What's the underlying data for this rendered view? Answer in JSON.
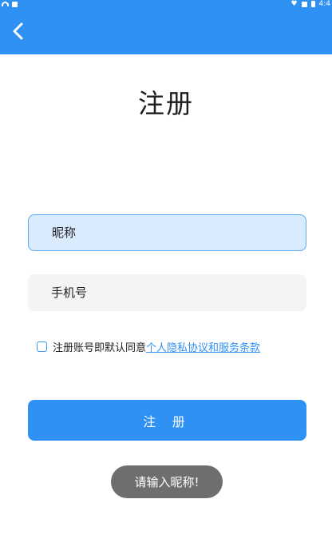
{
  "status_bar": {
    "time": "4:4",
    "icons": [
      "wifi-icon",
      "sim-icon",
      "signal-icon",
      "no-sim-icon",
      "battery-icon"
    ]
  },
  "app_bar": {
    "back_icon": "chevron-left-icon",
    "color": "#2f91f4"
  },
  "page": {
    "title": "注册"
  },
  "form": {
    "nickname_placeholder": "昵称",
    "nickname_value": "",
    "phone_placeholder": "手机号",
    "phone_value": "",
    "agree_text": "注册账号即默认同意",
    "agree_link": "个人隐私协议和服务条款",
    "agree_checked": false,
    "submit_label": "注 册"
  },
  "toast": {
    "message": "请输入昵称!"
  },
  "colors": {
    "accent": "#2f91f4",
    "input_focus_bg": "#d9ebfd",
    "input_bg": "#f4f4f6",
    "toast_bg": "#6e6e6e"
  }
}
